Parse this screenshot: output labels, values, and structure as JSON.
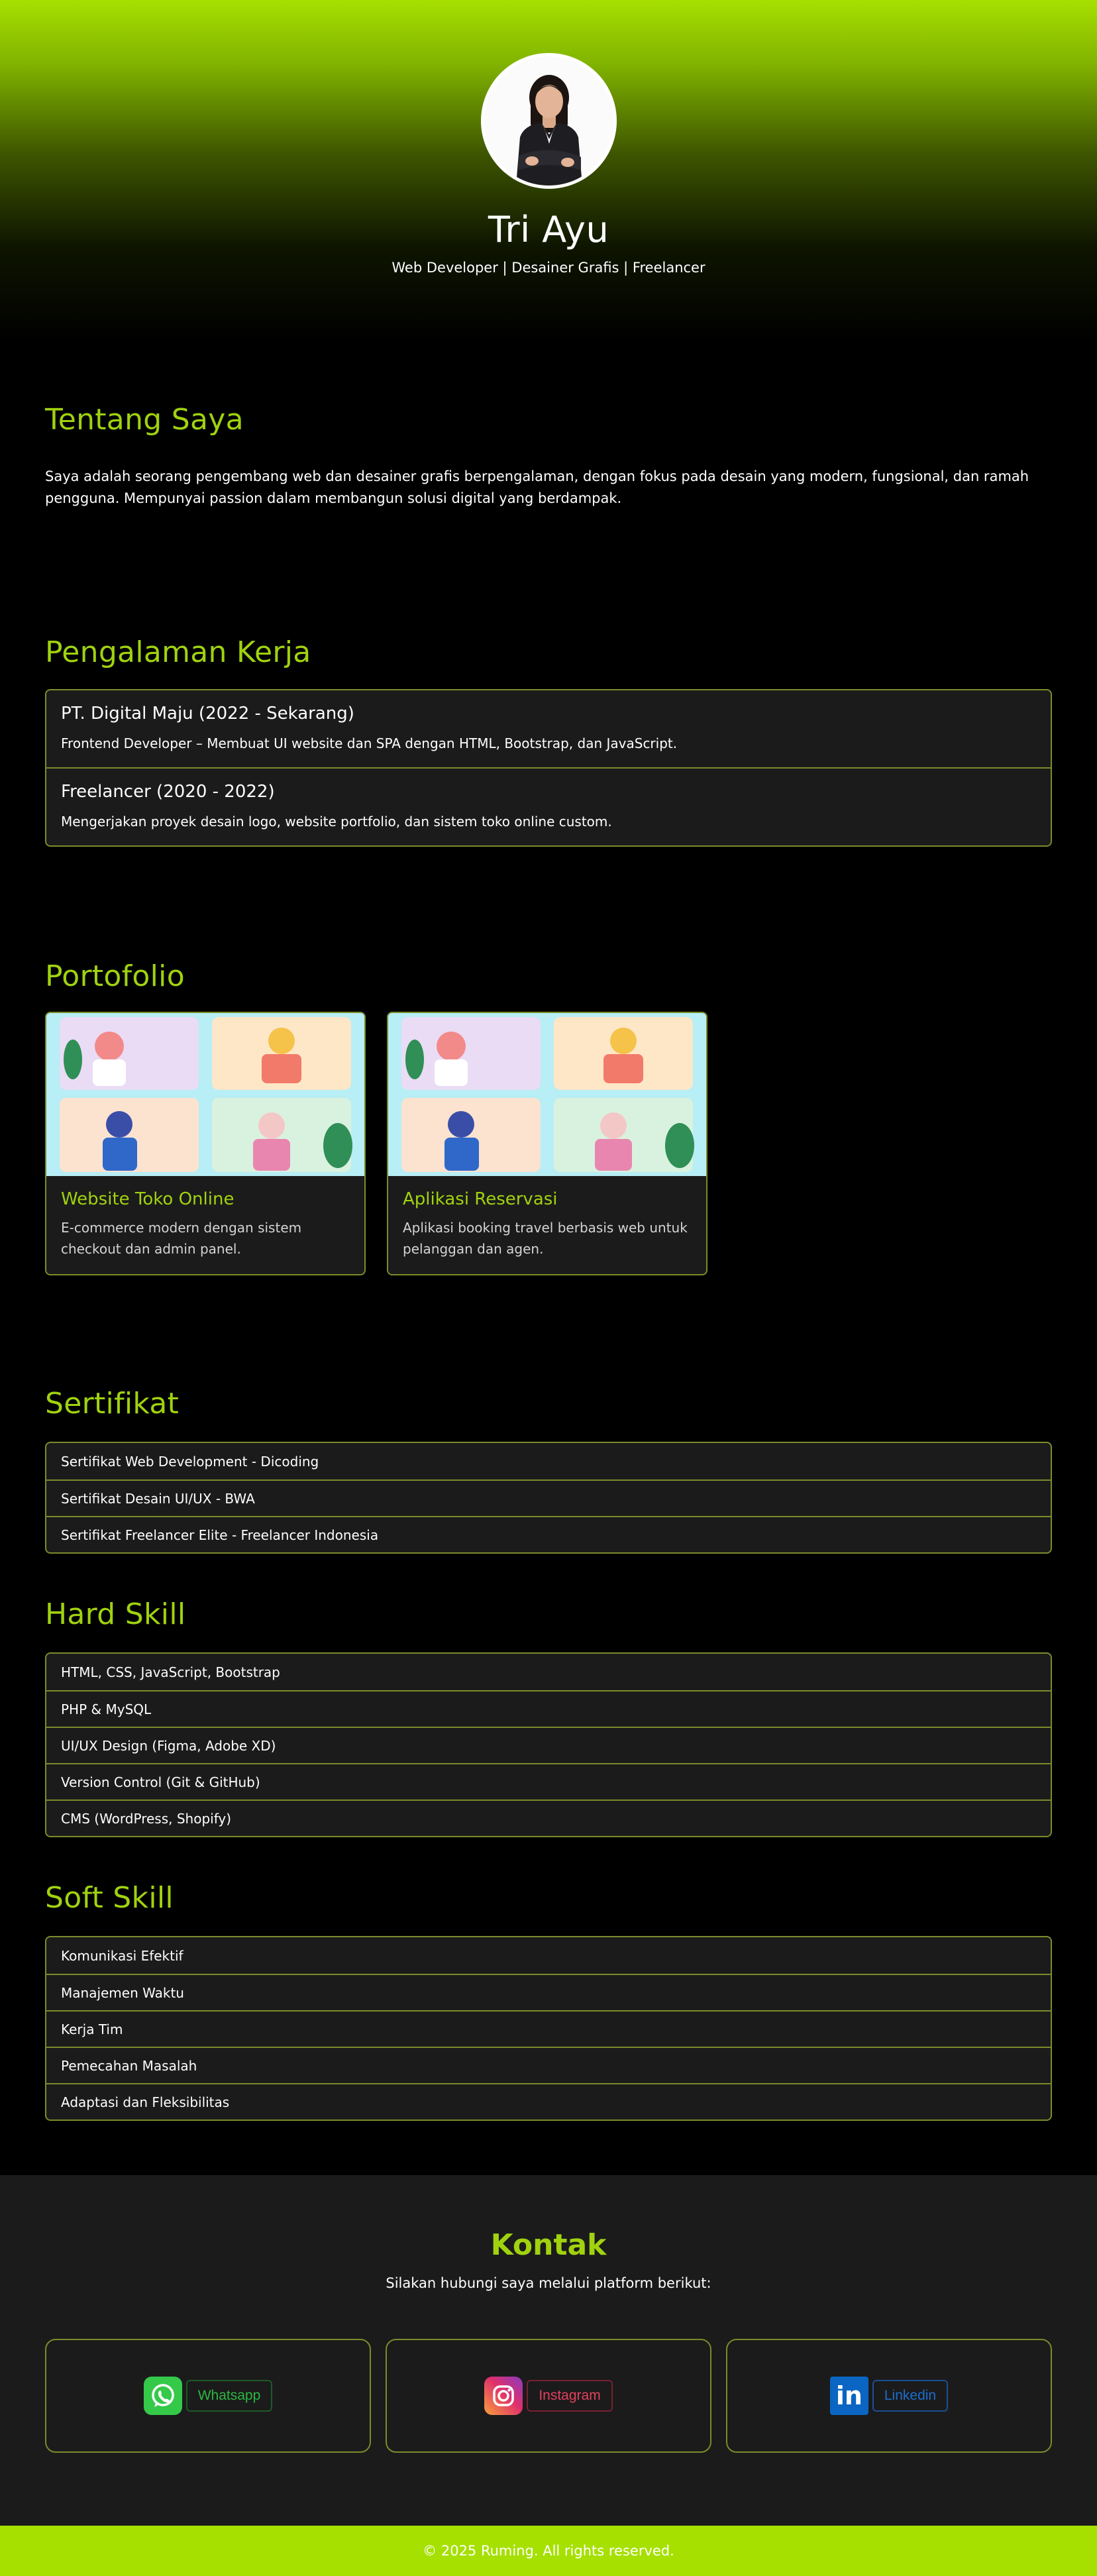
{
  "hero": {
    "name": "Tri Ayu",
    "tagline": "Web Developer | Desainer Grafis | Freelancer"
  },
  "about": {
    "title": "Tentang Saya",
    "text": "Saya adalah seorang pengembang web dan desainer grafis berpengalaman, dengan fokus pada desain yang modern, fungsional, dan ramah pengguna. Mempunyai passion dalam membangun solusi digital yang berdampak."
  },
  "experience": {
    "title": "Pengalaman Kerja",
    "items": [
      {
        "heading": "PT. Digital Maju (2022 - Sekarang)",
        "desc": "Frontend Developer – Membuat UI website dan SPA dengan HTML, Bootstrap, dan JavaScript."
      },
      {
        "heading": "Freelancer (2020 - 2022)",
        "desc": "Mengerjakan proyek desain logo, website portfolio, dan sistem toko online custom."
      }
    ]
  },
  "portfolio": {
    "title": "Portofolio",
    "cards": [
      {
        "title": "Website Toko Online",
        "desc": "E-commerce modern dengan sistem checkout dan admin panel."
      },
      {
        "title": "Aplikasi Reservasi",
        "desc": "Aplikasi booking travel berbasis web untuk pelanggan dan agen."
      }
    ]
  },
  "certificates": {
    "title": "Sertifikat",
    "items": [
      "Sertifikat Web Development - Dicoding",
      "Sertifikat Desain UI/UX - BWA",
      "Sertifikat Freelancer Elite - Freelancer Indonesia"
    ]
  },
  "hard_skill": {
    "title": "Hard Skill",
    "items": [
      "HTML, CSS, JavaScript, Bootstrap",
      "PHP & MySQL",
      "UI/UX Design (Figma, Adobe XD)",
      "Version Control (Git & GitHub)",
      "CMS (WordPress, Shopify)"
    ]
  },
  "soft_skill": {
    "title": "Soft Skill",
    "items": [
      "Komunikasi Efektif",
      "Manajemen Waktu",
      "Kerja Tim",
      "Pemecahan Masalah",
      "Adaptasi dan Fleksibilitas"
    ]
  },
  "contact": {
    "title": "Kontak",
    "subtitle": "Silakan hubungi saya melalui platform berikut:",
    "links": [
      {
        "label": "Whatsapp",
        "icon": "whatsapp-icon",
        "color": "#2bb741"
      },
      {
        "label": "Instagram",
        "icon": "instagram-icon",
        "color": "#e4405f"
      },
      {
        "label": "Linkedin",
        "icon": "linkedin-icon",
        "color": "#0a66c2"
      }
    ]
  },
  "footer": {
    "text": "© 2025 Ruming. All rights reserved."
  },
  "colors": {
    "accent": "#a0d20f",
    "border": "#7a8c2a",
    "panel": "#1b1b1b",
    "footer": "#a6e000"
  }
}
